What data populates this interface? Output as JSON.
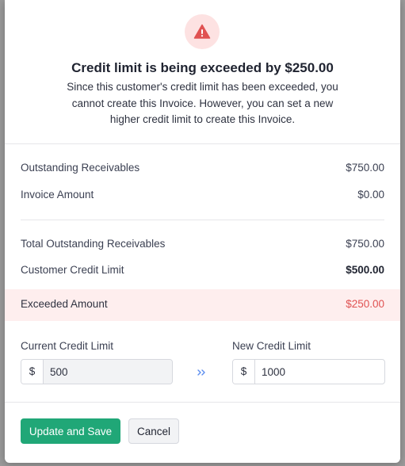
{
  "dialog": {
    "title": "Credit limit is being exceeded by $250.00",
    "subtitle": "Since this customer's credit limit has been exceeded, you cannot create this Invoice. However, you can set a new higher credit limit to create this Invoice.",
    "icon": "warning-triangle-icon",
    "accent_color": "#e05252"
  },
  "summary": {
    "outstanding_receivables": {
      "label": "Outstanding Receivables",
      "value": "$750.00"
    },
    "invoice_amount": {
      "label": "Invoice Amount",
      "value": "$0.00"
    },
    "total_outstanding_receivables": {
      "label": "Total Outstanding Receivables",
      "value": "$750.00"
    },
    "customer_credit_limit": {
      "label": "Customer Credit Limit",
      "value": "$500.00"
    },
    "exceeded_amount": {
      "label": "Exceeded Amount",
      "value": "$250.00"
    }
  },
  "credit_limit_form": {
    "current": {
      "label": "Current Credit Limit",
      "prefix": "$",
      "value": "500"
    },
    "new": {
      "label": "New Credit Limit",
      "prefix": "$",
      "value": "1000"
    },
    "arrow_icon": "double-chevron-right-icon"
  },
  "actions": {
    "update_label": "Update and Save",
    "cancel_label": "Cancel",
    "primary_color": "#20a777"
  }
}
